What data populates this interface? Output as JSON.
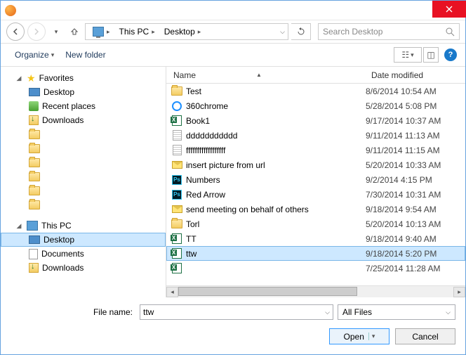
{
  "breadcrumb": {
    "root": "This PC",
    "current": "Desktop"
  },
  "search": {
    "placeholder": "Search Desktop"
  },
  "toolbar": {
    "organize": "Organize",
    "newfolder": "New folder"
  },
  "columns": {
    "name": "Name",
    "date": "Date modified"
  },
  "sidebar": {
    "favorites": "Favorites",
    "desktop": "Desktop",
    "recent": "Recent places",
    "downloads": "Downloads",
    "thispc": "This PC",
    "pc_desktop": "Desktop",
    "pc_documents": "Documents",
    "pc_downloads": "Downloads"
  },
  "files": [
    {
      "name": "Test",
      "date": "8/6/2014 10:54 AM",
      "type": "folder"
    },
    {
      "name": "360chrome",
      "date": "5/28/2014 5:08 PM",
      "type": "ie"
    },
    {
      "name": "Book1",
      "date": "9/17/2014 10:37 AM",
      "type": "xls"
    },
    {
      "name": "ddddddddddd",
      "date": "9/11/2014 11:13 AM",
      "type": "txt"
    },
    {
      "name": "ffffffffffffffffff",
      "date": "9/11/2014 11:15 AM",
      "type": "txt"
    },
    {
      "name": "insert picture from url",
      "date": "5/20/2014 10:33 AM",
      "type": "mail"
    },
    {
      "name": "Numbers",
      "date": "9/2/2014 4:15 PM",
      "type": "ps"
    },
    {
      "name": "Red Arrow",
      "date": "7/30/2014 10:31 AM",
      "type": "ps"
    },
    {
      "name": "send meeting on behalf of others",
      "date": "9/18/2014 9:54 AM",
      "type": "mail"
    },
    {
      "name": "Torl",
      "date": "5/20/2014 10:13 AM",
      "type": "folder"
    },
    {
      "name": "TT",
      "date": "9/18/2014 9:40 AM",
      "type": "xls"
    },
    {
      "name": "ttw",
      "date": "9/18/2014 5:20 PM",
      "type": "xls",
      "selected": true
    },
    {
      "name": "",
      "date": "7/25/2014 11:28 AM",
      "type": "xls"
    }
  ],
  "filename": {
    "label": "File name:",
    "value": "ttw"
  },
  "filetype": "All Files",
  "buttons": {
    "open": "Open",
    "cancel": "Cancel"
  },
  "help": "?"
}
